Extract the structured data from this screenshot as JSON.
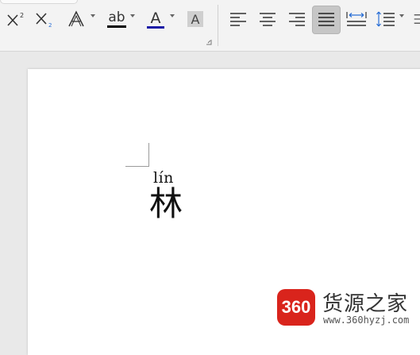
{
  "toolbar": {
    "superscript_icon": "superscript-icon",
    "subscript_icon": "subscript-icon",
    "text_effect_icon": "text-effect-icon",
    "highlight_label": "ab",
    "highlight_color": "#000000",
    "font_color_label": "A",
    "font_color": "#1a1aa6",
    "char_shading_label": "A",
    "align_left_icon": "align-left-icon",
    "align_center_icon": "align-center-icon",
    "align_right_icon": "align-right-icon",
    "justify_icon": "justify-icon",
    "justify_active": true,
    "distributed_icon": "distributed-icon",
    "line_spacing_icon": "line-spacing-icon"
  },
  "document": {
    "pinyin": "lín",
    "character": "林"
  },
  "watermark": {
    "badge": "360",
    "title": "货源之家",
    "url": "www.360hyzj.com",
    "color": "#d9241c"
  }
}
